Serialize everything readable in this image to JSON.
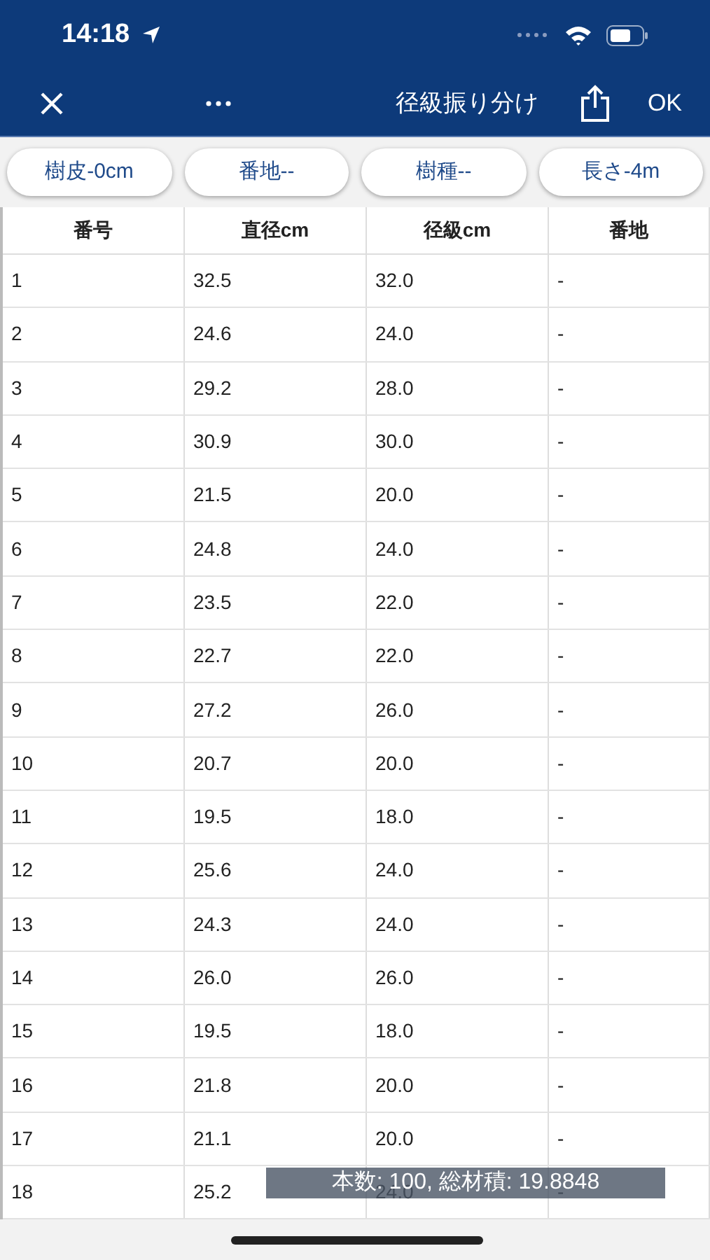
{
  "status_bar": {
    "time": "14:18"
  },
  "nav": {
    "title": "径級振り分け",
    "ok": "OK"
  },
  "chips": [
    "樹皮-0cm",
    "番地--",
    "樹種--",
    "長さ-4m"
  ],
  "table": {
    "columns": [
      "番号",
      "直径cm",
      "径級cm",
      "番地"
    ],
    "rows": [
      [
        "1",
        "32.5",
        "32.0",
        "-"
      ],
      [
        "2",
        "24.6",
        "24.0",
        "-"
      ],
      [
        "3",
        "29.2",
        "28.0",
        "-"
      ],
      [
        "4",
        "30.9",
        "30.0",
        "-"
      ],
      [
        "5",
        "21.5",
        "20.0",
        "-"
      ],
      [
        "6",
        "24.8",
        "24.0",
        "-"
      ],
      [
        "7",
        "23.5",
        "22.0",
        "-"
      ],
      [
        "8",
        "22.7",
        "22.0",
        "-"
      ],
      [
        "9",
        "27.2",
        "26.0",
        "-"
      ],
      [
        "10",
        "20.7",
        "20.0",
        "-"
      ],
      [
        "11",
        "19.5",
        "18.0",
        "-"
      ],
      [
        "12",
        "25.6",
        "24.0",
        "-"
      ],
      [
        "13",
        "24.3",
        "24.0",
        "-"
      ],
      [
        "14",
        "26.0",
        "26.0",
        "-"
      ],
      [
        "15",
        "19.5",
        "18.0",
        "-"
      ],
      [
        "16",
        "21.8",
        "20.0",
        "-"
      ],
      [
        "17",
        "21.1",
        "20.0",
        "-"
      ],
      [
        "18",
        "25.2",
        "24.0",
        "-"
      ]
    ]
  },
  "toast": "本数: 100, 総材積: 19.8848"
}
